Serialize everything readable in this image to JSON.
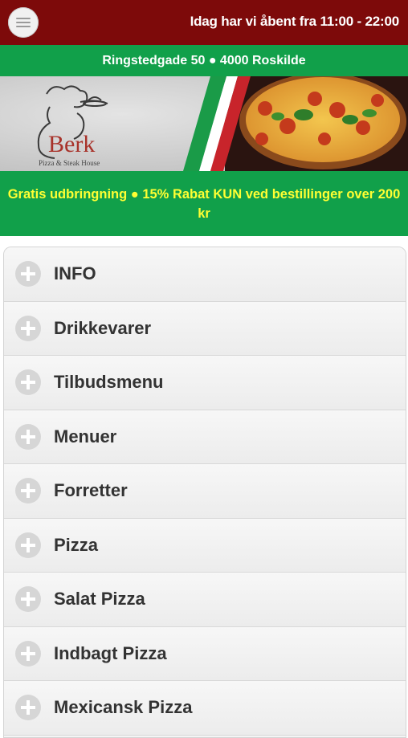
{
  "header": {
    "hours_text": "Idag har vi åbent fra 11:00 - 22:00",
    "menu_icon": "hamburger-icon"
  },
  "address": {
    "text": "Ringstedgade 50 ● 4000 Roskilde"
  },
  "banner": {
    "brand_name": "Berk",
    "brand_subtitle": "Pizza & Steak House"
  },
  "promo": {
    "text": "Gratis udbringning ● 15% Rabat KUN ved bestillinger over 200 kr"
  },
  "colors": {
    "header_bg": "#7d0a0a",
    "green": "#11a04a",
    "promo_text": "#ffff33"
  },
  "categories": [
    {
      "label": "INFO"
    },
    {
      "label": "Drikkevarer"
    },
    {
      "label": "Tilbudsmenu"
    },
    {
      "label": "Menuer"
    },
    {
      "label": "Forretter"
    },
    {
      "label": "Pizza"
    },
    {
      "label": "Salat Pizza"
    },
    {
      "label": "Indbagt Pizza"
    },
    {
      "label": "Mexicansk Pizza"
    }
  ]
}
